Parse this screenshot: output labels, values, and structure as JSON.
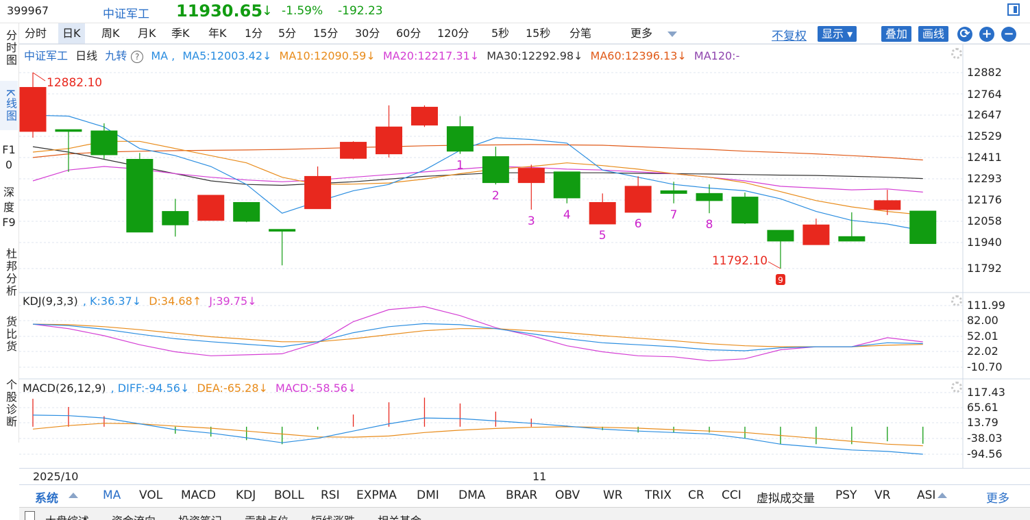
{
  "header": {
    "code": "399967",
    "name": "中证军工",
    "price": "11930.65",
    "arrow": "↓",
    "pct": "-1.59%",
    "change": "-192.23"
  },
  "left_tabs": [
    {
      "label": "分时图"
    },
    {
      "label": "K线图",
      "active": true
    },
    {
      "label": "F10"
    },
    {
      "label": "深度F9"
    },
    {
      "label": "杜邦分析"
    },
    {
      "label": "货比货"
    },
    {
      "label": "个股诊断"
    }
  ],
  "period_tabs": [
    "分时",
    "日K",
    "周K",
    "月K",
    "季K",
    "年K",
    "1分",
    "5分",
    "15分",
    "30分",
    "60分",
    "120分",
    "5秒",
    "15秒",
    "分笔",
    "更多"
  ],
  "period_active": "日K",
  "toolbar": {
    "adjust": "不复权",
    "show": "显示",
    "overlay": "叠加",
    "draw": "画线",
    "refresh_icon": "refresh-icon",
    "zoom_in": "+",
    "zoom_out": "−"
  },
  "colors": {
    "up": "#e8281e",
    "down": "#119c11",
    "ma5": "#2a8de0",
    "ma10": "#e88b1a",
    "ma20": "#d43ed4",
    "ma30": "#333333",
    "ma60": "#e05a18",
    "ma120": "#8e44ad",
    "accent": "#2a6fc8",
    "magenta_label": "#cc22cc"
  },
  "main_label": {
    "name": "中证军工",
    "period": "日线",
    "nine": "九转",
    "help": "?",
    "ma": "MA ,",
    "ma5": "MA5:12003.42↓",
    "ma10": "MA10:12090.59↓",
    "ma20": "MA20:12217.31↓",
    "ma30": "MA30:12292.98↓",
    "ma60": "MA60:12396.13↓",
    "ma120": "MA120:-"
  },
  "price_axis": [
    "12882",
    "12764",
    "12647",
    "12529",
    "12411",
    "12293",
    "12176",
    "12058",
    "11940",
    "11792"
  ],
  "annotations": {
    "high": "12882.10",
    "low": "11792.10",
    "nine_badge": "9"
  },
  "kdj_label": {
    "name": "KDJ(9,3,3)",
    "k": ", K:36.37↓",
    "d": "D:34.68↑",
    "j": "J:39.75↓"
  },
  "kdj_axis": [
    "111.99",
    "82.00",
    "52.01",
    "22.02",
    "-10.70"
  ],
  "macd_label": {
    "name": "MACD(26,12,9)",
    "diff": ", DIFF:-94.56↓",
    "dea": "DEA:-65.28↓",
    "macd": "MACD:-58.56↓"
  },
  "macd_axis": [
    "117.43",
    "65.61",
    "13.79",
    "-38.03",
    "-94.56"
  ],
  "date_axis": [
    "2025/10",
    "11"
  ],
  "indicator_tabs": [
    "系统",
    "MA",
    "VOL",
    "MACD",
    "KDJ",
    "BOLL",
    "RSI",
    "EXPMA",
    "DMI",
    "DMA",
    "BRAR",
    "OBV",
    "WR",
    "TRIX",
    "CR",
    "CCI",
    "虚拟成交量",
    "PSY",
    "VR",
    "ASI"
  ],
  "indicator_more": "更多",
  "bottom_tabs": [
    "大盘综述",
    "资金流向",
    "投资笔记",
    "贡献点位",
    "短线涨跌",
    "相关基金"
  ],
  "chart_data": {
    "type": "candlestick",
    "candles": [
      {
        "o": 12555,
        "h": 12882.1,
        "l": 12520,
        "c": 12800
      },
      {
        "o": 12565,
        "h": 12565,
        "l": 12330,
        "c": 12555
      },
      {
        "o": 12558,
        "h": 12600,
        "l": 12400,
        "c": 12425
      },
      {
        "o": 12400,
        "h": 12435,
        "l": 11995,
        "c": 11995
      },
      {
        "o": 12110,
        "h": 12180,
        "l": 11970,
        "c": 12035
      },
      {
        "o": 12060,
        "h": 12195,
        "l": 12060,
        "c": 12200
      },
      {
        "o": 12160,
        "h": 12160,
        "l": 12050,
        "c": 12055
      },
      {
        "o": 12010,
        "h": 12010,
        "l": 11810,
        "c": 12000
      },
      {
        "o": 12125,
        "h": 12360,
        "l": 12125,
        "c": 12305
      },
      {
        "o": 12405,
        "h": 12500,
        "l": 12400,
        "c": 12495
      },
      {
        "o": 12430,
        "h": 12700,
        "l": 12410,
        "c": 12580
      },
      {
        "o": 12590,
        "h": 12700,
        "l": 12580,
        "c": 12690
      },
      {
        "o": 12582,
        "h": 12640,
        "l": 12430,
        "c": 12445
      },
      {
        "o": 12415,
        "h": 12470,
        "l": 12260,
        "c": 12270
      },
      {
        "o": 12270,
        "h": 12370,
        "l": 12120,
        "c": 12350
      },
      {
        "o": 12330,
        "h": 12330,
        "l": 12155,
        "c": 12185
      },
      {
        "o": 12040,
        "h": 12210,
        "l": 12040,
        "c": 12160
      },
      {
        "o": 12105,
        "h": 12305,
        "l": 12105,
        "c": 12250
      },
      {
        "o": 12225,
        "h": 12275,
        "l": 12155,
        "c": 12210
      },
      {
        "o": 12210,
        "h": 12260,
        "l": 12100,
        "c": 12170
      },
      {
        "o": 12190,
        "h": 12215,
        "l": 12040,
        "c": 12045
      },
      {
        "o": 12005,
        "h": 12005,
        "l": 11792.1,
        "c": 11945
      },
      {
        "o": 11925,
        "h": 12070,
        "l": 11925,
        "c": 12035
      },
      {
        "o": 11970,
        "h": 12105,
        "l": 11955,
        "c": 11945
      },
      {
        "o": 12120,
        "h": 12230,
        "l": 12090,
        "c": 12170
      },
      {
        "o": 12112,
        "h": 12112,
        "l": 11930,
        "c": 11931
      }
    ],
    "ma5": [
      12645,
      12640,
      12580,
      12460,
      12420,
      12360,
      12260,
      12100,
      12165,
      12225,
      12260,
      12340,
      12450,
      12520,
      12510,
      12490,
      12340,
      12300,
      12260,
      12240,
      12225,
      12180,
      12110,
      12060,
      12040,
      12003.42
    ],
    "ma10": [
      12440,
      12460,
      12500,
      12500,
      12460,
      12420,
      12380,
      12300,
      12260,
      12262,
      12268,
      12290,
      12320,
      12345,
      12360,
      12380,
      12365,
      12345,
      12320,
      12300,
      12270,
      12220,
      12170,
      12135,
      12110,
      12090.59
    ],
    "ma20": [
      12280,
      12340,
      12360,
      12345,
      12320,
      12300,
      12285,
      12275,
      12285,
      12300,
      12315,
      12330,
      12345,
      12360,
      12355,
      12345,
      12340,
      12330,
      12320,
      12300,
      12280,
      12250,
      12240,
      12230,
      12235,
      12217.31
    ],
    "ma30": [
      12470,
      12440,
      12400,
      12360,
      12320,
      12280,
      12260,
      12255,
      12265,
      12275,
      12290,
      12305,
      12315,
      12325,
      12325,
      12325,
      12325,
      12322,
      12320,
      12318,
      12315,
      12312,
      12310,
      12305,
      12300,
      12292.98
    ],
    "ma60": [
      12410,
      12430,
      12440,
      12445,
      12448,
      12450,
      12452,
      12455,
      12460,
      12465,
      12470,
      12475,
      12478,
      12480,
      12482,
      12480,
      12478,
      12470,
      12462,
      12455,
      12445,
      12438,
      12430,
      12420,
      12410,
      12396.13
    ],
    "nine_count_labels": [
      "1",
      "2",
      "3",
      "4",
      "5",
      "6",
      "7",
      "8"
    ],
    "kdj": {
      "k": [
        75,
        72,
        65,
        55,
        46,
        40,
        35,
        30,
        40,
        58,
        70,
        76,
        74,
        66,
        56,
        46,
        38,
        34,
        30,
        24,
        22,
        28,
        30,
        30,
        38,
        36.37
      ],
      "d": [
        75,
        74,
        70,
        64,
        57,
        50,
        45,
        40,
        40,
        46,
        54,
        62,
        66,
        66,
        62,
        58,
        52,
        47,
        42,
        36,
        32,
        30,
        30,
        30,
        33,
        34.68
      ],
      "j": [
        75,
        66,
        52,
        34,
        20,
        12,
        14,
        16,
        38,
        80,
        104,
        110,
        92,
        68,
        52,
        32,
        20,
        12,
        10,
        2,
        6,
        24,
        30,
        30,
        48,
        39.75
      ]
    },
    "macd": {
      "diff": [
        40,
        38,
        30,
        10,
        -10,
        -22,
        -38,
        -55,
        -40,
        -15,
        10,
        30,
        28,
        20,
        12,
        2,
        -8,
        -15,
        -20,
        -25,
        -40,
        -60,
        -70,
        -80,
        -85,
        -94.56
      ],
      "dea": [
        -8,
        4,
        12,
        10,
        2,
        -5,
        -15,
        -25,
        -35,
        -36,
        -32,
        -20,
        -12,
        -6,
        -2,
        0,
        -2,
        -5,
        -10,
        -15,
        -20,
        -30,
        -40,
        -50,
        -60,
        -65.28
      ],
      "hist": [
        96,
        68,
        36,
        0,
        -24,
        -34,
        -46,
        -60,
        -10,
        42,
        84,
        100,
        80,
        52,
        28,
        4,
        -12,
        -20,
        -20,
        -20,
        -40,
        -60,
        -60,
        -60,
        -50,
        -58.56
      ]
    }
  }
}
